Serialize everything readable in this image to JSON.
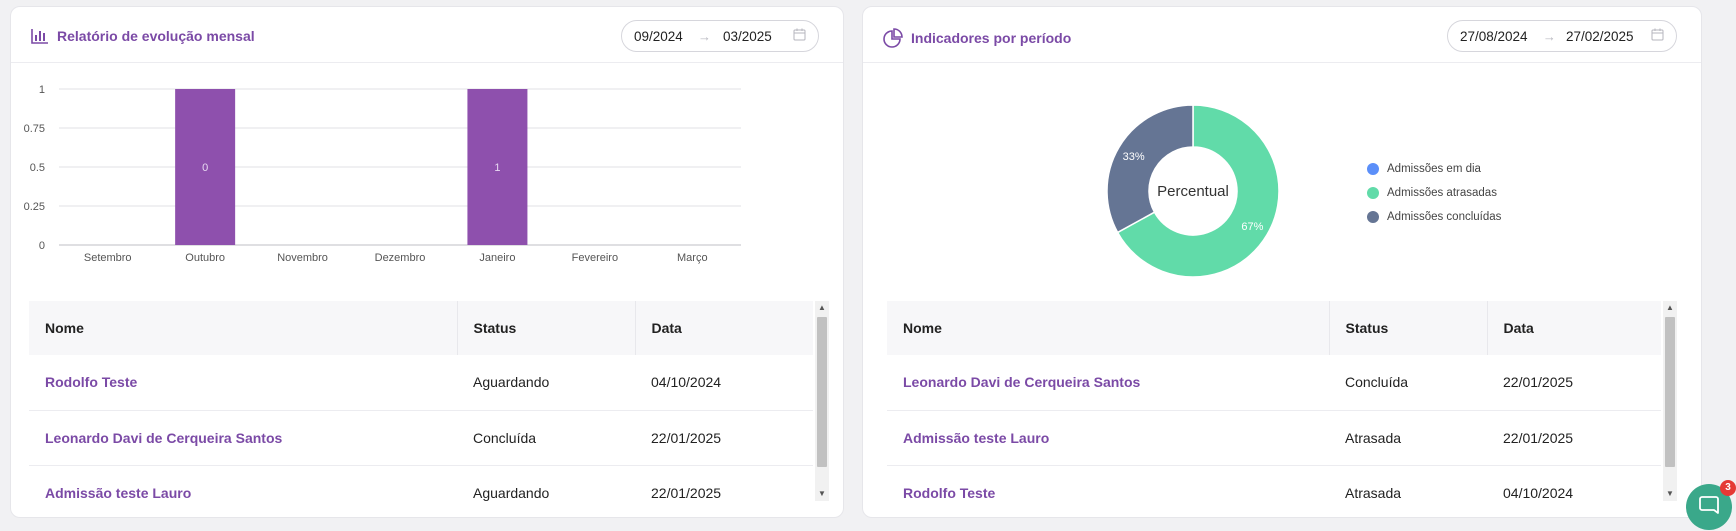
{
  "left_card": {
    "title": "Relatório de evolução mensal",
    "date_from": "09/2024",
    "date_to": "03/2025",
    "arrow": "→"
  },
  "right_card": {
    "title": "Indicadores por período",
    "date_from": "27/08/2024",
    "date_to": "27/02/2025",
    "arrow": "→"
  },
  "chart_data": [
    {
      "type": "bar",
      "categories": [
        "Setembro",
        "Outubro",
        "Novembro",
        "Dezembro",
        "Janeiro",
        "Fevereiro",
        "Março"
      ],
      "values": [
        0,
        1,
        0,
        0,
        1,
        0,
        0
      ],
      "data_labels": [
        "",
        "0",
        "",
        "",
        "1",
        "",
        ""
      ],
      "yticks": [
        "0",
        "0.25",
        "0.5",
        "0.75",
        "1"
      ],
      "ylim": [
        0,
        1
      ],
      "grid": true,
      "bar_color": "#8e50ad"
    },
    {
      "type": "pie",
      "center_label": "Percentual",
      "series": [
        {
          "name": "Admissões em dia",
          "value": 0,
          "label": "",
          "color": "#5b8ff9"
        },
        {
          "name": "Admissões atrasadas",
          "value": 67,
          "label": "67%",
          "color": "#61dba9"
        },
        {
          "name": "Admissões concluídas",
          "value": 33,
          "label": "33%",
          "color": "#657594"
        }
      ],
      "legend": "right"
    }
  ],
  "left_table": {
    "columns": [
      "Nome",
      "Status",
      "Data"
    ],
    "rows": [
      {
        "name": "Rodolfo Teste",
        "status": "Aguardando",
        "date": "04/10/2024"
      },
      {
        "name": "Leonardo Davi de Cerqueira Santos",
        "status": "Concluída",
        "date": "22/01/2025"
      },
      {
        "name": "Admissão teste Lauro",
        "status": "Aguardando",
        "date": "22/01/2025"
      }
    ]
  },
  "right_table": {
    "columns": [
      "Nome",
      "Status",
      "Data"
    ],
    "rows": [
      {
        "name": "Leonardo Davi de Cerqueira Santos",
        "status": "Concluída",
        "date": "22/01/2025"
      },
      {
        "name": "Admissão teste Lauro",
        "status": "Atrasada",
        "date": "22/01/2025"
      },
      {
        "name": "Rodolfo Teste",
        "status": "Atrasada",
        "date": "04/10/2024"
      }
    ]
  },
  "chat": {
    "badge": "3"
  },
  "colors": {
    "accent": "#7b4aa6",
    "chat": "#3aa88a",
    "badge": "#e53935"
  }
}
